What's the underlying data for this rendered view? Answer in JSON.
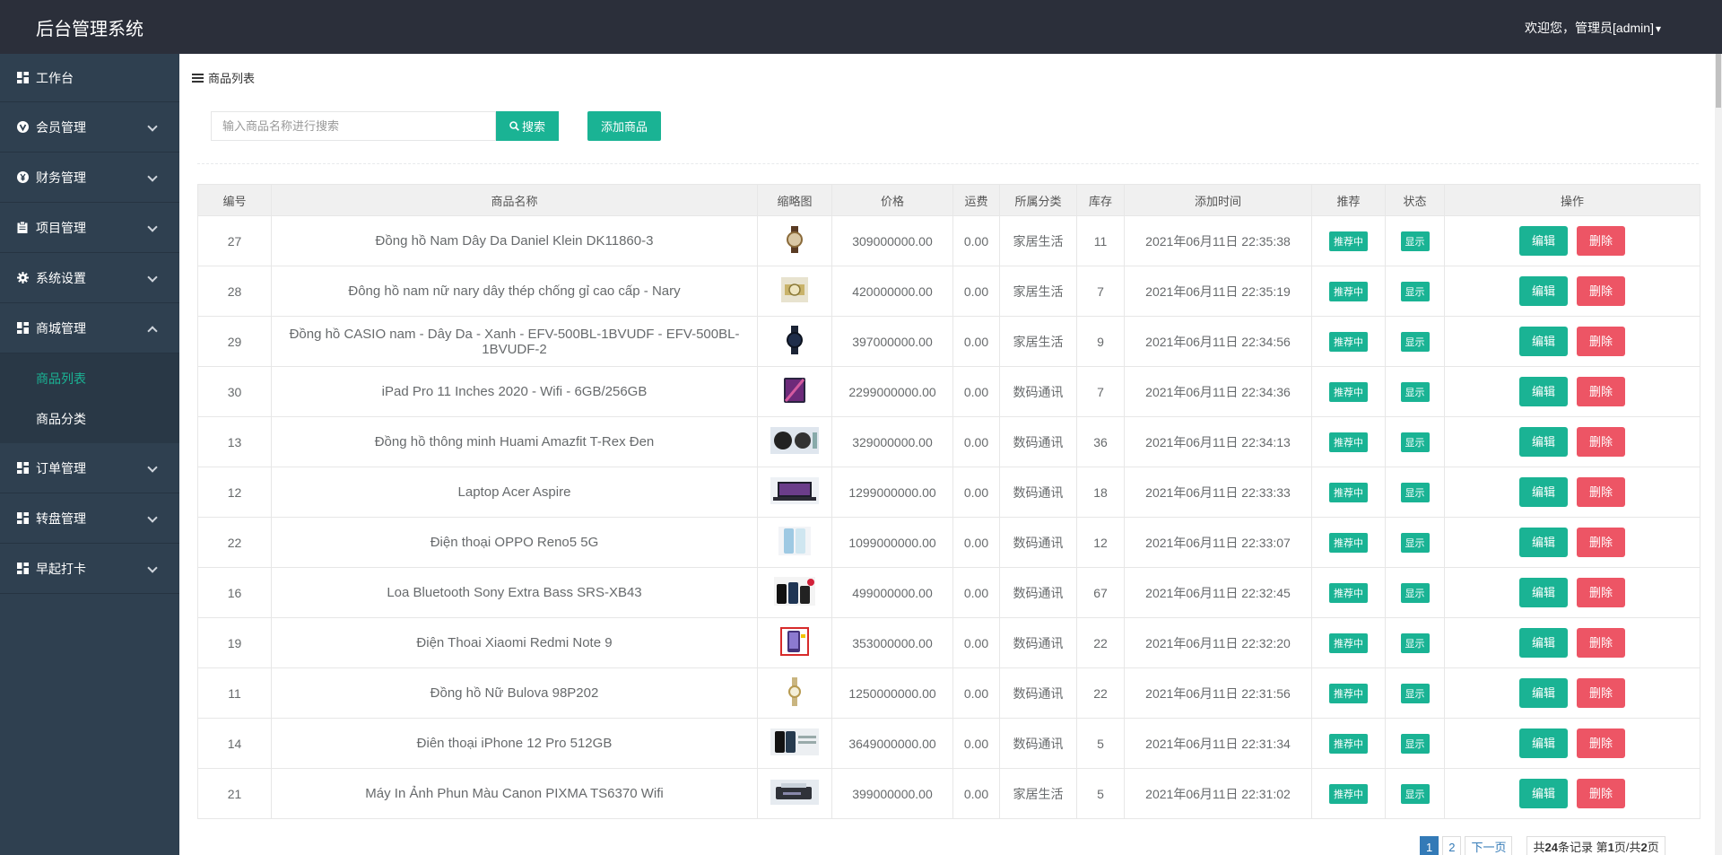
{
  "header": {
    "title": "后台管理系统",
    "user_label": "欢迎您，管理员[admin]"
  },
  "sidebar": {
    "items": [
      {
        "label": "工作台",
        "icon": "dashboard-icon"
      },
      {
        "label": "会员管理",
        "icon": "vip-icon"
      },
      {
        "label": "财务管理",
        "icon": "yen-icon"
      },
      {
        "label": "项目管理",
        "icon": "clipboard-icon"
      },
      {
        "label": "系统设置",
        "icon": "gear-icon"
      },
      {
        "label": "商城管理",
        "icon": "dashboard-icon"
      },
      {
        "label": "订单管理",
        "icon": "dashboard-icon"
      },
      {
        "label": "转盘管理",
        "icon": "dashboard-icon"
      },
      {
        "label": "早起打卡",
        "icon": "dashboard-icon"
      }
    ],
    "submenu": [
      {
        "label": "商品列表",
        "active": true
      },
      {
        "label": "商品分类",
        "active": false
      }
    ]
  },
  "page": {
    "breadcrumb": "商品列表",
    "search_placeholder": "输入商品名称进行搜索",
    "search_label": "搜索",
    "add_label": "添加商品"
  },
  "table": {
    "headers": [
      "编号",
      "商品名称",
      "缩略图",
      "价格",
      "运费",
      "所属分类",
      "库存",
      "添加时间",
      "推荐",
      "状态",
      "操作"
    ],
    "rows": [
      {
        "id": "27",
        "name": "Đồng hồ Nam Dây Da Daniel Klein DK11860-3",
        "price": "309000000.00",
        "shipping": "0.00",
        "category": "家居生活",
        "stock": "11",
        "time": "2021年06月11日 22:35:38",
        "recommend": "推荐中",
        "status": "显示",
        "thumb": "watch-brown"
      },
      {
        "id": "28",
        "name": "Đông hồ nam nữ nary dây thép chống gỉ cao cấp - Nary",
        "price": "420000000.00",
        "shipping": "0.00",
        "category": "家居生活",
        "stock": "7",
        "time": "2021年06月11日 22:35:19",
        "recommend": "推荐中",
        "status": "显示",
        "thumb": "watch-gold"
      },
      {
        "id": "29",
        "name": "Đồng hồ CASIO nam - Dây Da - Xanh - EFV-500BL-1BVUDF - EFV-500BL-1BVUDF-2",
        "price": "397000000.00",
        "shipping": "0.00",
        "category": "家居生活",
        "stock": "9",
        "time": "2021年06月11日 22:34:56",
        "recommend": "推荐中",
        "status": "显示",
        "thumb": "watch-dark"
      },
      {
        "id": "30",
        "name": "iPad Pro 11 Inches 2020 - Wifi - 6GB/256GB",
        "price": "2299000000.00",
        "shipping": "0.00",
        "category": "数码通讯",
        "stock": "7",
        "time": "2021年06月11日 22:34:36",
        "recommend": "推荐中",
        "status": "显示",
        "thumb": "tablet"
      },
      {
        "id": "13",
        "name": "Đồng hồ thông minh Huami Amazfit T-Rex Đen",
        "price": "329000000.00",
        "shipping": "0.00",
        "category": "数码通讯",
        "stock": "36",
        "time": "2021年06月11日 22:34:13",
        "recommend": "推荐中",
        "status": "显示",
        "thumb": "smartwatch"
      },
      {
        "id": "12",
        "name": "Laptop Acer Aspire",
        "price": "1299000000.00",
        "shipping": "0.00",
        "category": "数码通讯",
        "stock": "18",
        "time": "2021年06月11日 22:33:33",
        "recommend": "推荐中",
        "status": "显示",
        "thumb": "laptop"
      },
      {
        "id": "22",
        "name": "Điện thoại OPPO Reno5 5G",
        "price": "1099000000.00",
        "shipping": "0.00",
        "category": "数码通讯",
        "stock": "12",
        "time": "2021年06月11日 22:33:07",
        "recommend": "推荐中",
        "status": "显示",
        "thumb": "phone-blue"
      },
      {
        "id": "16",
        "name": "Loa Bluetooth Sony Extra Bass SRS-XB43",
        "price": "499000000.00",
        "shipping": "0.00",
        "category": "数码通讯",
        "stock": "67",
        "time": "2021年06月11日 22:32:45",
        "recommend": "推荐中",
        "status": "显示",
        "thumb": "speaker"
      },
      {
        "id": "19",
        "name": "Điện Thoai Xiaomi Redmi Note 9",
        "price": "353000000.00",
        "shipping": "0.00",
        "category": "数码通讯",
        "stock": "22",
        "time": "2021年06月11日 22:32:20",
        "recommend": "推荐中",
        "status": "显示",
        "thumb": "phone-red"
      },
      {
        "id": "11",
        "name": "Đồng hồ Nữ Bulova 98P202",
        "price": "1250000000.00",
        "shipping": "0.00",
        "category": "数码通讯",
        "stock": "22",
        "time": "2021年06月11日 22:31:56",
        "recommend": "推荐中",
        "status": "显示",
        "thumb": "watch-lady"
      },
      {
        "id": "14",
        "name": "Điên thoại iPhone 12 Pro 512GB",
        "price": "3649000000.00",
        "shipping": "0.00",
        "category": "数码通讯",
        "stock": "5",
        "time": "2021年06月11日 22:31:34",
        "recommend": "推荐中",
        "status": "显示",
        "thumb": "iphone"
      },
      {
        "id": "21",
        "name": "Máy In Ảnh Phun Màu Canon PIXMA TS6370 Wifi",
        "price": "399000000.00",
        "shipping": "0.00",
        "category": "家居生活",
        "stock": "5",
        "time": "2021年06月11日 22:31:02",
        "recommend": "推荐中",
        "status": "显示",
        "thumb": "printer"
      }
    ],
    "edit_label": "编辑",
    "delete_label": "删除"
  },
  "pagination": {
    "pages": [
      "1",
      "2"
    ],
    "next_label": "下一页",
    "info_prefix": "共",
    "total_records": "24",
    "info_mid": "条记录 第",
    "current_page": "1",
    "info_mid2": "页/共",
    "total_pages": "2",
    "info_suffix": "页"
  },
  "colors": {
    "topbar": "#2b2f3a",
    "sidebar": "#2f4050",
    "primary": "#1ab394",
    "danger": "#ed5565",
    "active_link": "#1ab394"
  }
}
